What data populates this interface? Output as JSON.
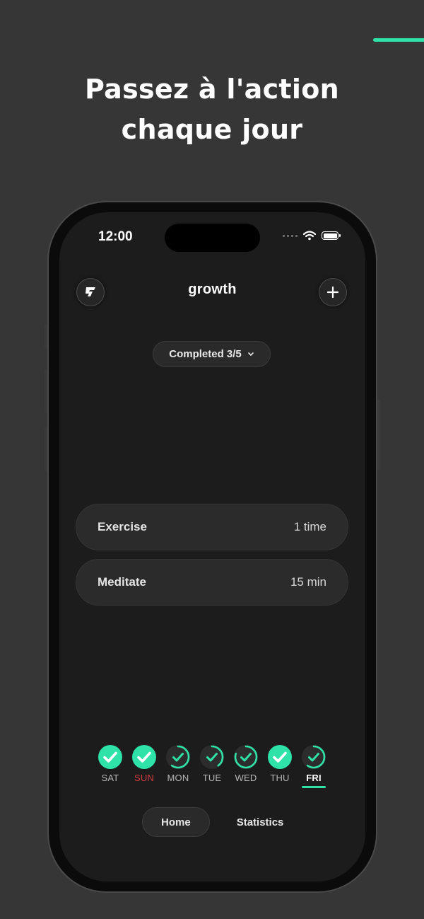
{
  "headline": {
    "line1": "Passez à l'action",
    "line2": "chaque jour"
  },
  "status_bar": {
    "time": "12:00",
    "icons": [
      "signal-dots-icon",
      "wifi-icon",
      "battery-icon"
    ]
  },
  "header": {
    "title": "growth",
    "logo_icon": "app-logo-icon",
    "add_icon": "plus-icon"
  },
  "filter": {
    "label": "Completed 3/5",
    "icon": "chevron-down-icon"
  },
  "habits": [
    {
      "name": "Exercise",
      "value": "1 time"
    },
    {
      "name": "Meditate",
      "value": "15 min"
    }
  ],
  "week": [
    {
      "label": "SAT",
      "state": "done",
      "progress": 1.0
    },
    {
      "label": "SUN",
      "state": "done",
      "progress": 1.0
    },
    {
      "label": "MON",
      "state": "partial",
      "progress": 0.6
    },
    {
      "label": "TUE",
      "state": "partial",
      "progress": 0.4
    },
    {
      "label": "WED",
      "state": "partial",
      "progress": 0.8
    },
    {
      "label": "THU",
      "state": "done",
      "progress": 1.0
    },
    {
      "label": "FRI",
      "state": "partial",
      "progress": 0.6,
      "today": true
    }
  ],
  "nav": {
    "home": "Home",
    "statistics": "Statistics"
  },
  "colors": {
    "accent": "#2ee2a8",
    "sunday": "#d23c3c",
    "background": "#363636",
    "screen": "#1c1c1c"
  }
}
